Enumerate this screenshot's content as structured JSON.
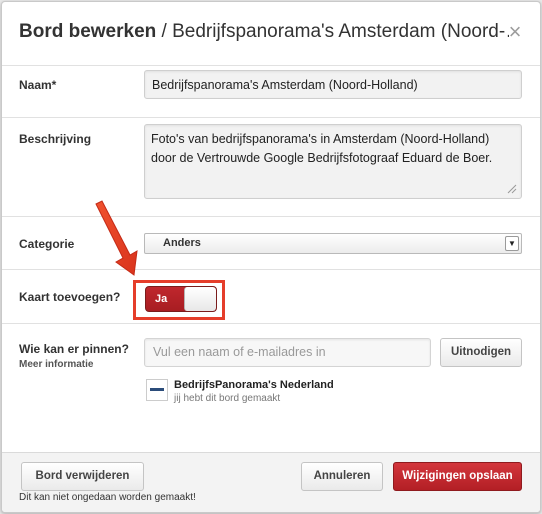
{
  "header": {
    "title_bold": "Bord bewerken",
    "title_sep": " / ",
    "title_rest": "Bedrijfspanorama's Amsterdam (Noord-…",
    "close_glyph": "×"
  },
  "form": {
    "name_label": "Naam*",
    "name_value": "Bedrijfspanorama's Amsterdam (Noord-Holland)",
    "description_label": "Beschrijving",
    "description_line1": "Foto's van bedrijfspanorama's in Amsterdam (Noord-Holland)",
    "description_line2": "door de Vertrouwde Google Bedrijfsfotograaf Eduard de Boer.",
    "category_label": "Categorie",
    "category_value": "Anders",
    "map_label": "Kaart toevoegen?",
    "map_toggle_text": "Ja",
    "map_toggle_on": true,
    "pinners_label": "Wie kan er pinnen?",
    "more_info": "Meer informatie",
    "invite_placeholder": "Vul een naam of e-mailadres in",
    "invite_button": "Uitnodigen",
    "collaborator_name": "BedrijfsPanorama's Nederland",
    "collaborator_sub": "jij hebt dit bord gemaakt"
  },
  "footer": {
    "delete_button": "Bord verwijderen",
    "delete_note": "Dit kan niet ongedaan worden gemaakt!",
    "cancel_button": "Annuleren",
    "save_button": "Wijzigingen opslaan"
  },
  "colors": {
    "accent_red": "#c0272d",
    "highlight_red": "#e53d2a"
  },
  "icons": {
    "close": "close-icon",
    "arrow": "red-arrow-annotation",
    "select": "select-arrow-icon"
  }
}
